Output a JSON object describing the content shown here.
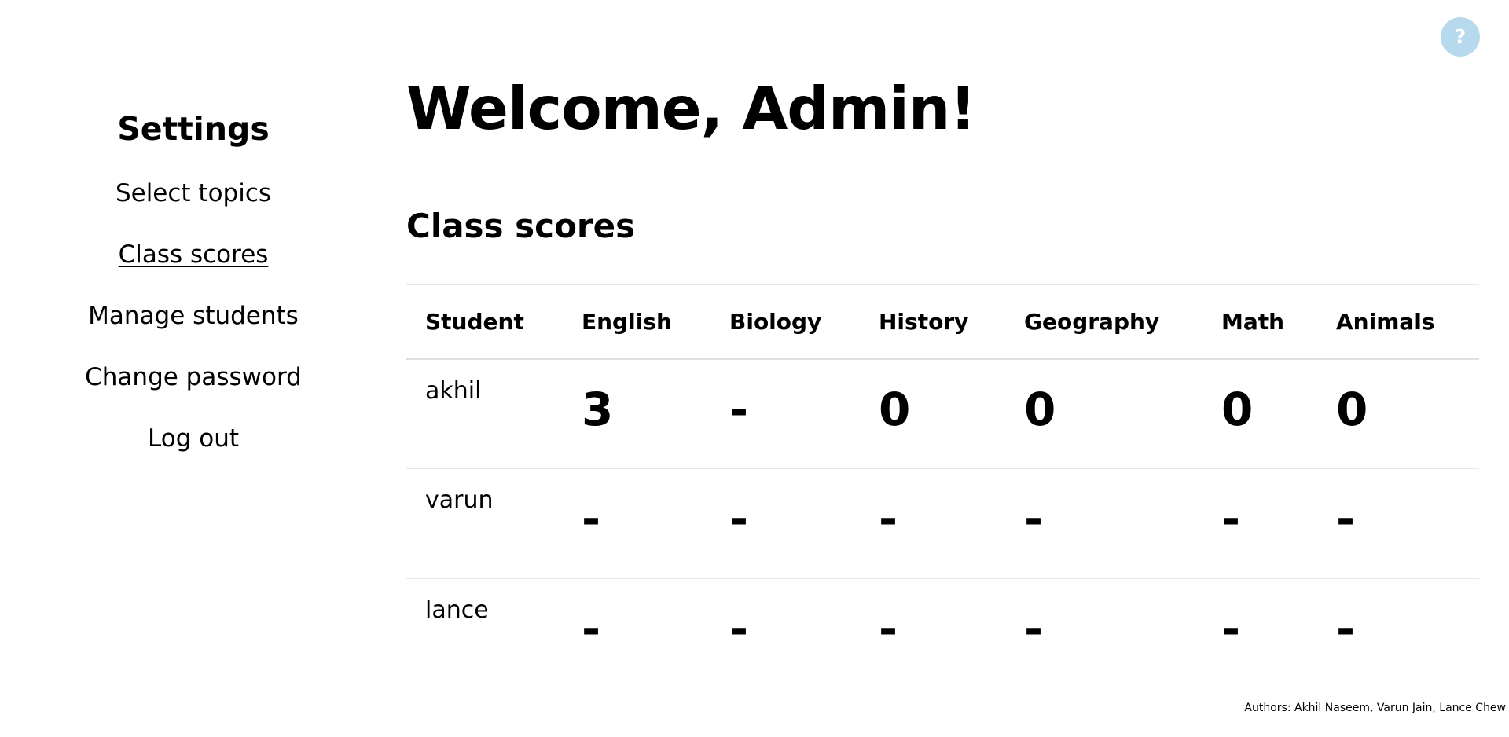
{
  "sidebar": {
    "title": "Settings",
    "items": [
      {
        "label": "Select topics",
        "active": false
      },
      {
        "label": "Class scores",
        "active": true
      },
      {
        "label": "Manage students",
        "active": false
      },
      {
        "label": "Change password",
        "active": false
      },
      {
        "label": "Log out",
        "active": false
      }
    ]
  },
  "help": {
    "label": "?",
    "icon": "question-mark-icon",
    "color": "#b7d9ee"
  },
  "header": {
    "title": "Welcome, Admin!"
  },
  "section": {
    "title": "Class scores"
  },
  "table": {
    "columns": [
      "Student",
      "English",
      "Biology",
      "History",
      "Geography",
      "Math",
      "Animals"
    ],
    "rows": [
      {
        "student": "akhil",
        "scores": [
          "3",
          "-",
          "0",
          "0",
          "0",
          "0"
        ]
      },
      {
        "student": "varun",
        "scores": [
          "-",
          "-",
          "-",
          "-",
          "-",
          "-"
        ]
      },
      {
        "student": "lance",
        "scores": [
          "-",
          "-",
          "-",
          "-",
          "-",
          "-"
        ]
      }
    ]
  },
  "footer": {
    "text": "Authors: Akhil Naseem, Varun Jain, Lance Chew"
  }
}
